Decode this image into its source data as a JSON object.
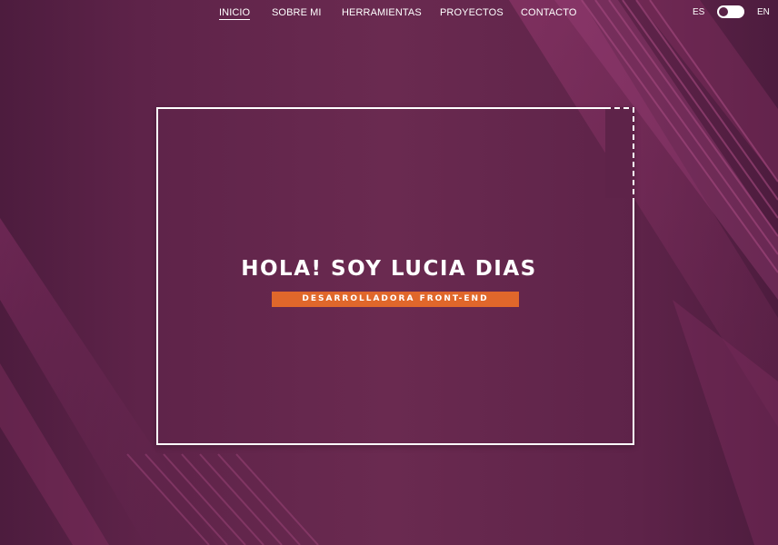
{
  "nav": {
    "items": [
      {
        "label": "INICIO",
        "active": true
      },
      {
        "label": "SOBRE MI",
        "active": false
      },
      {
        "label": "HERRAMIENTAS",
        "active": false
      },
      {
        "label": "PROYECTOS",
        "active": false
      },
      {
        "label": "CONTACTO",
        "active": false
      }
    ]
  },
  "language": {
    "left": "ES",
    "right": "EN",
    "toggle_state": "ES"
  },
  "hero": {
    "title": "HOLA! SOY LUCIA DIAS",
    "subtitle": "DESARROLLADORA FRONT-END"
  },
  "colors": {
    "background": "#5e2349",
    "accent": "#e0672b",
    "text": "#ffffff",
    "stripe": "#8e3568"
  }
}
